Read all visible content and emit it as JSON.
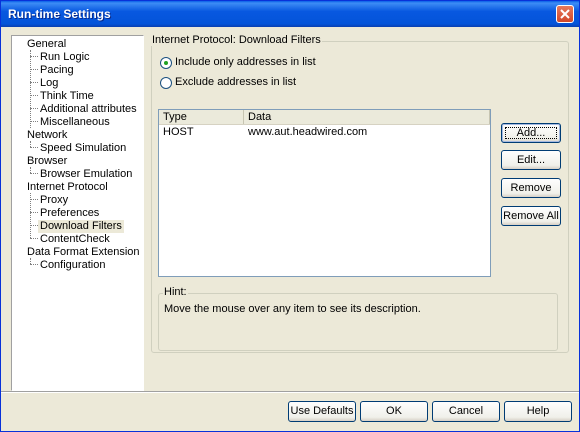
{
  "window": {
    "title": "Run-time Settings"
  },
  "tree": {
    "items": [
      {
        "label": "General"
      },
      {
        "label": "Run Logic"
      },
      {
        "label": "Pacing"
      },
      {
        "label": "Log"
      },
      {
        "label": "Think Time"
      },
      {
        "label": "Additional attributes"
      },
      {
        "label": "Miscellaneous"
      },
      {
        "label": "Network"
      },
      {
        "label": "Speed Simulation"
      },
      {
        "label": "Browser"
      },
      {
        "label": "Browser Emulation"
      },
      {
        "label": "Internet Protocol"
      },
      {
        "label": "Proxy"
      },
      {
        "label": "Preferences"
      },
      {
        "label": "Download Filters",
        "selected": true
      },
      {
        "label": "ContentCheck"
      },
      {
        "label": "Data Format Extension"
      },
      {
        "label": "Configuration"
      }
    ]
  },
  "panel": {
    "group_title": "Internet Protocol: Download Filters",
    "radio_include": "Include only addresses in list",
    "radio_exclude": "Exclude addresses in list",
    "selected_radio": "include"
  },
  "list": {
    "columns": [
      "Type",
      "Data"
    ],
    "rows": [
      {
        "type": "HOST",
        "data": "www.aut.headwired.com"
      }
    ]
  },
  "buttons": {
    "add": "Add...",
    "edit": "Edit...",
    "remove": "Remove",
    "remove_all": "Remove All"
  },
  "hint": {
    "title": "Hint:",
    "text": "Move the mouse over any item to see its description."
  },
  "footer": {
    "use_defaults": "Use Defaults",
    "ok": "OK",
    "cancel": "Cancel",
    "help": "Help"
  },
  "colors": {
    "titlebar": "#0858e0",
    "selection": "#ece9d8"
  }
}
